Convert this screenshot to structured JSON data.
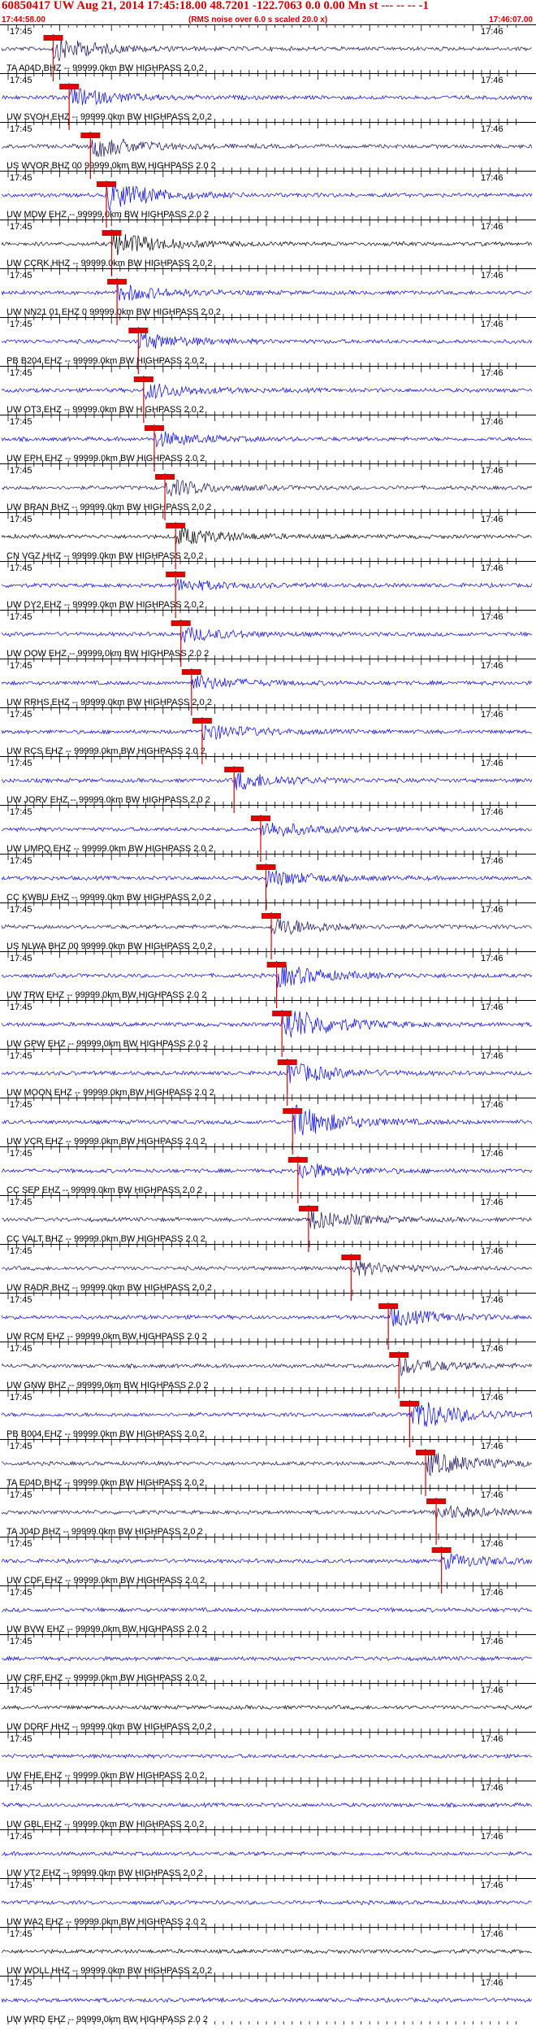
{
  "header": {
    "title": "60850417 UW Aug 21, 2014 17:45:18.00   48.7201 -122.7063  0.0 0.00 Mn st --- -- --  -1",
    "left_time": "17:44:58.00",
    "center_note": "(RMS noise over 6.0 s scaled 20.0 x)",
    "right_time": "17:46:07.00"
  },
  "time_labels": {
    "left": "17:45",
    "right": "17:46"
  },
  "colors": {
    "header": "#d00000",
    "pick": "#e00000",
    "trace_blue": "#0000ee",
    "trace_navy": "#1a0a5a",
    "trace_black": "#000000"
  },
  "stations": [
    {
      "label": "TA A04D BHZ -- 99999.0km BW  HIGHPASS  2.0  2",
      "color": "navy",
      "pick": 0.1,
      "amp": 0.55
    },
    {
      "label": "UW SVOH EHZ -- 99999.0km BW  HIGHPASS  2.0  2",
      "color": "blue",
      "pick": 0.13,
      "amp": 0.45
    },
    {
      "label": "US WVOR BHZ 00 99999.0km BW  HIGHPASS  2.0  2",
      "color": "navy",
      "pick": 0.17,
      "amp": 0.55
    },
    {
      "label": "UW MDW EHZ -- 99999.0km BW  HIGHPASS  2.0  2",
      "color": "blue",
      "pick": 0.2,
      "amp": 0.7
    },
    {
      "label": "UW CCRK HHZ -- 99999.0km BW  HIGHPASS  2.0  2",
      "color": "black",
      "pick": 0.21,
      "amp": 0.6
    },
    {
      "label": "UW NN21 01 EHZ 0 99999.0km BW  HIGHPASS  2.0  2",
      "color": "blue",
      "pick": 0.22,
      "amp": 0.4
    },
    {
      "label": "PB B204 EHZ -- 99999.0km BW  HIGHPASS  2.0  2",
      "color": "blue",
      "pick": 0.26,
      "amp": 0.4
    },
    {
      "label": "UW OT3 EHZ -- 99999.0km BW  HIGHPASS  2.0  2",
      "color": "blue",
      "pick": 0.27,
      "amp": 0.4
    },
    {
      "label": "UW EPH EHZ -- 99999.0km BW  HIGHPASS  2.0  2",
      "color": "blue",
      "pick": 0.29,
      "amp": 0.35
    },
    {
      "label": "UW BRAN BHZ -- 99999.0km BW  HIGHPASS  2.0  2",
      "color": "navy",
      "pick": 0.31,
      "amp": 0.4
    },
    {
      "label": "CN VGZ HHZ -- 99999.0km BW  HIGHPASS  2.0  2",
      "color": "black",
      "pick": 0.33,
      "amp": 0.45
    },
    {
      "label": "UW DY2 EHZ -- 99999.0km BW  HIGHPASS  2.0  2",
      "color": "blue",
      "pick": 0.33,
      "amp": 0.3
    },
    {
      "label": "UW OOW EHZ -- 99999.0km BW  HIGHPASS  2.0  2",
      "color": "blue",
      "pick": 0.34,
      "amp": 0.35
    },
    {
      "label": "UW RRHS EHZ -- 99999.0km BW  HIGHPASS  2.0  2",
      "color": "blue",
      "pick": 0.36,
      "amp": 0.35
    },
    {
      "label": "UW RCS EHZ -- 99999.0km BW  HIGHPASS  2.0  2",
      "color": "blue",
      "pick": 0.38,
      "amp": 0.4
    },
    {
      "label": "UW JORV EHZ -- 99999.0km BW  HIGHPASS  2.0  2",
      "color": "blue",
      "pick": 0.44,
      "amp": 0.45
    },
    {
      "label": "UW UMPQ EHZ -- 99999.0km BW  HIGHPASS  2.0  2",
      "color": "blue",
      "pick": 0.49,
      "amp": 0.4
    },
    {
      "label": "CC KWBU EHZ -- 99999.0km BW  HIGHPASS  2.0  2",
      "color": "blue",
      "pick": 0.5,
      "amp": 0.4
    },
    {
      "label": "US NLWA BHZ 00 99999.0km BW  HIGHPASS  2.0  2",
      "color": "navy",
      "pick": 0.51,
      "amp": 0.45
    },
    {
      "label": "UW TRW EHZ -- 99999.0km BW  HIGHPASS  2.0  2",
      "color": "blue",
      "pick": 0.52,
      "amp": 0.55
    },
    {
      "label": "UW GPW EHZ -- 99999.0km BW  HIGHPASS  2.0  2",
      "color": "blue",
      "pick": 0.53,
      "amp": 0.9
    },
    {
      "label": "UW MOON EHZ -- 99999.0km BW  HIGHPASS  2.0  2",
      "color": "blue",
      "pick": 0.54,
      "amp": 0.5
    },
    {
      "label": "UW VCR EHZ -- 99999.0km BW  HIGHPASS  2.0  2",
      "color": "blue",
      "pick": 0.55,
      "amp": 0.8
    },
    {
      "label": "CC SEP EHZ -- 99999.0km BW  HIGHPASS  2.0  2",
      "color": "blue",
      "pick": 0.56,
      "amp": 0.4
    },
    {
      "label": "CC VALT BHZ -- 99999.0km BW  HIGHPASS  2.0  2",
      "color": "navy",
      "pick": 0.58,
      "amp": 0.5
    },
    {
      "label": "UW RADR BHZ -- 99999.0km BW  HIGHPASS  2.0  2",
      "color": "navy",
      "pick": 0.66,
      "amp": 0.35
    },
    {
      "label": "UW RCM EHZ -- 99999.0km BW  HIGHPASS  2.0  2",
      "color": "blue",
      "pick": 0.73,
      "amp": 0.45
    },
    {
      "label": "UW GNW BHZ -- 99999.0km BW  HIGHPASS  2.0  2",
      "color": "navy",
      "pick": 0.75,
      "amp": 0.4
    },
    {
      "label": "PB B004 EHZ -- 99999.0km BW  HIGHPASS  2.0  2",
      "color": "blue",
      "pick": 0.77,
      "amp": 0.8
    },
    {
      "label": "TA E04D BHZ -- 99999.0km BW  HIGHPASS  2.0  2",
      "color": "navy",
      "pick": 0.8,
      "amp": 0.6
    },
    {
      "label": "TA J04D BHZ -- 99999.0km BW  HIGHPASS  2.0  2",
      "color": "navy",
      "pick": 0.82,
      "amp": 0.35
    },
    {
      "label": "UW CDF EHZ -- 99999.0km BW  HIGHPASS  2.0  2",
      "color": "blue",
      "pick": 0.83,
      "amp": 0.35
    },
    {
      "label": "UW BVW EHZ -- 99999.0km BW  HIGHPASS  2.0  2",
      "color": "blue",
      "pick": null,
      "amp": 0.25
    },
    {
      "label": "UW CRF EHZ -- 99999.0km BW  HIGHPASS  2.0  2",
      "color": "blue",
      "pick": null,
      "amp": 0.3
    },
    {
      "label": "UW DDRF HHZ -- 99999.0km BW  HIGHPASS  2.0  2",
      "color": "black",
      "pick": null,
      "amp": 0.3
    },
    {
      "label": "UW FHE EHZ -- 99999.0km BW  HIGHPASS  2.0  2",
      "color": "blue",
      "pick": null,
      "amp": 0.3
    },
    {
      "label": "UW GBL EHZ -- 99999.0km BW  HIGHPASS  2.0  2",
      "color": "blue",
      "pick": null,
      "amp": 0.3
    },
    {
      "label": "UW VT2 EHZ -- 99999.0km BW  HIGHPASS  2.0  2",
      "color": "blue",
      "pick": null,
      "amp": 0.3
    },
    {
      "label": "UW WA2 EHZ -- 99999.0km BW  HIGHPASS  2.0  2",
      "color": "blue",
      "pick": null,
      "amp": 0.3
    },
    {
      "label": "UW WOLL HHZ -- 99999.0km BW  HIGHPASS  2.0  2",
      "color": "black",
      "pick": null,
      "amp": 0.35
    },
    {
      "label": "UW WRD EHZ -- 99999.0km BW  HIGHPASS  2.0  2",
      "color": "blue",
      "pick": null,
      "amp": 0.3
    }
  ]
}
